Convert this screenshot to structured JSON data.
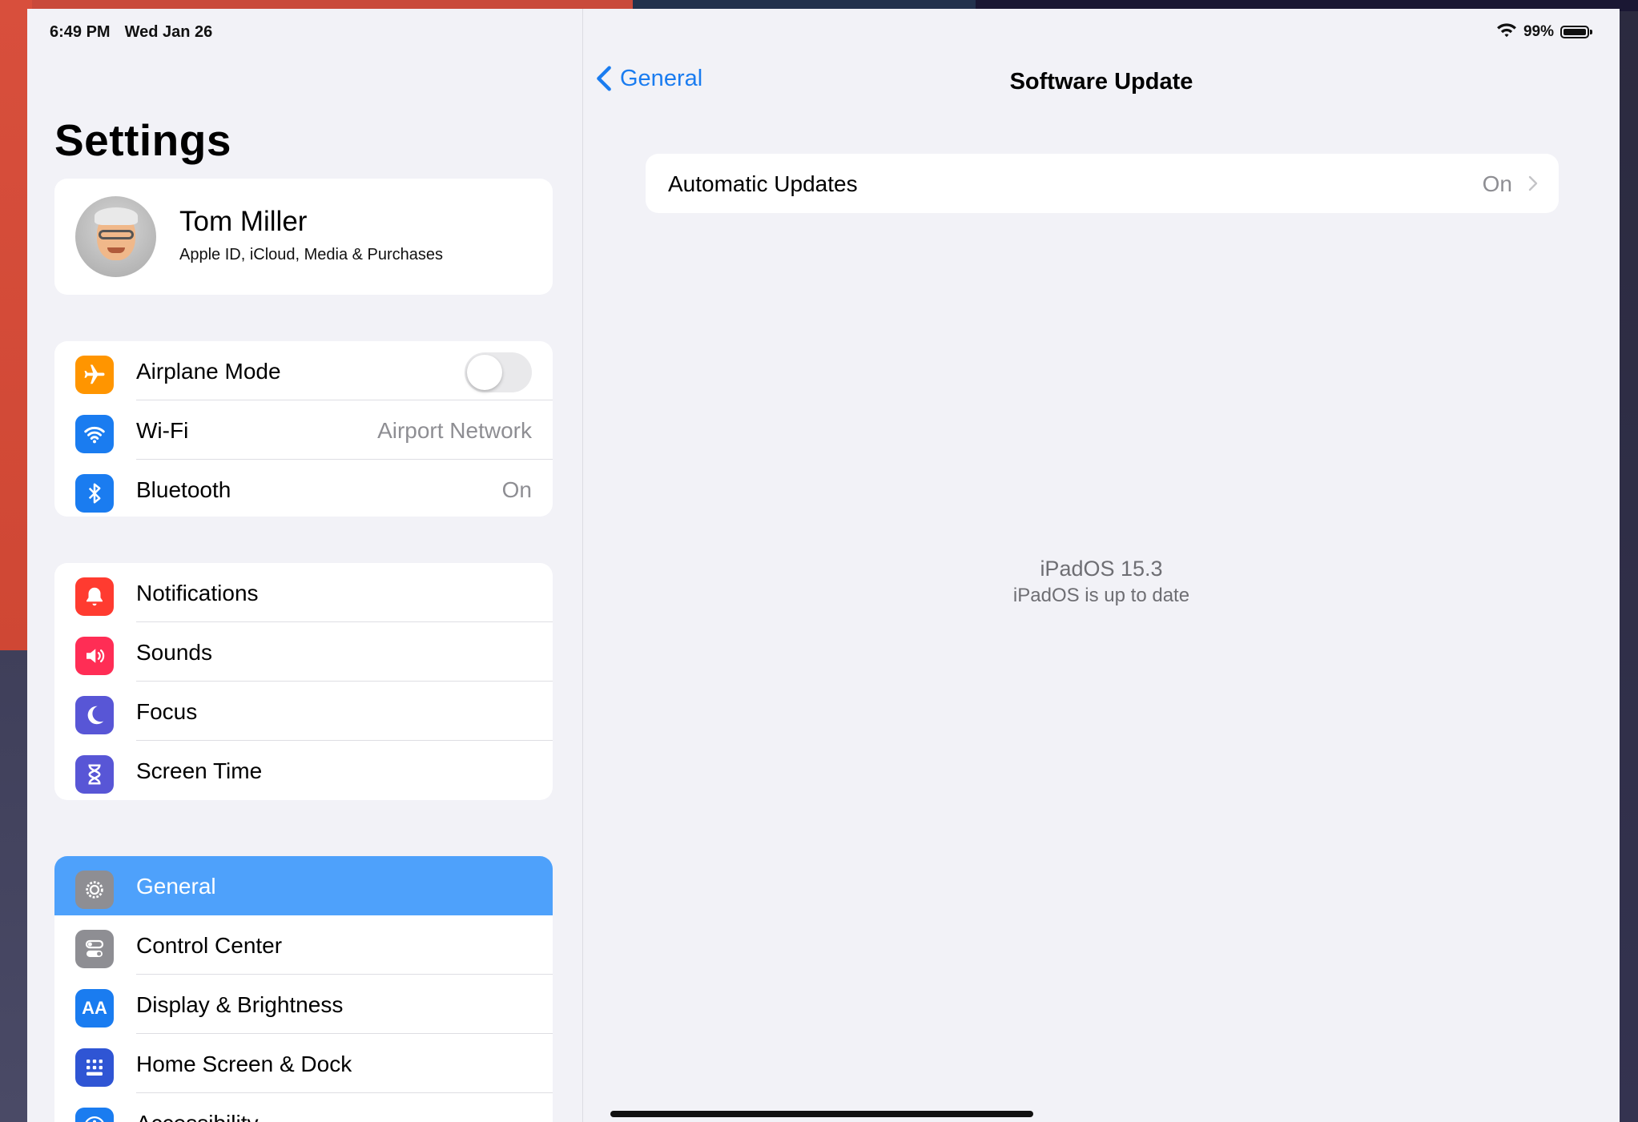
{
  "status_bar": {
    "time": "6:49 PM",
    "date": "Wed Jan 26",
    "battery": "99%"
  },
  "sidebar": {
    "title": "Settings",
    "profile": {
      "name": "Tom Miller",
      "subtitle": "Apple ID, iCloud, Media & Purchases"
    },
    "connectivity": [
      {
        "label": "Airplane Mode",
        "icon": "airplane-icon",
        "color": "#ff9500",
        "toggle": false
      },
      {
        "label": "Wi-Fi",
        "icon": "wifi-icon",
        "color": "#1a7cf0",
        "value": "Airport Network"
      },
      {
        "label": "Bluetooth",
        "icon": "bluetooth-icon",
        "color": "#1a7cf0",
        "value": "On"
      }
    ],
    "notifications": [
      {
        "label": "Notifications",
        "icon": "bell-icon",
        "color": "#ff3b30"
      },
      {
        "label": "Sounds",
        "icon": "speaker-icon",
        "color": "#ff2d55"
      },
      {
        "label": "Focus",
        "icon": "moon-icon",
        "color": "#5856d6"
      },
      {
        "label": "Screen Time",
        "icon": "hourglass-icon",
        "color": "#5856d6"
      }
    ],
    "general": [
      {
        "label": "General",
        "icon": "gear-icon",
        "color": "#8e8e93",
        "selected": true
      },
      {
        "label": "Control Center",
        "icon": "switches-icon",
        "color": "#8e8e93"
      },
      {
        "label": "Display & Brightness",
        "icon": "text-size-icon",
        "color": "#1a7cf0",
        "glyph": "AA"
      },
      {
        "label": "Home Screen & Dock",
        "icon": "app-grid-icon",
        "color": "#2f55d4"
      },
      {
        "label": "Accessibility",
        "icon": "accessibility-icon",
        "color": "#1a7cf0"
      }
    ]
  },
  "detail": {
    "back_label": "General",
    "title": "Software Update",
    "automatic_updates": {
      "label": "Automatic Updates",
      "value": "On"
    },
    "version": "iPadOS 15.3",
    "message": "iPadOS is up to date"
  },
  "colors": {
    "accent": "#1a7cf0",
    "selected_row": "#4ea1fb",
    "background": "#f2f2f7"
  }
}
